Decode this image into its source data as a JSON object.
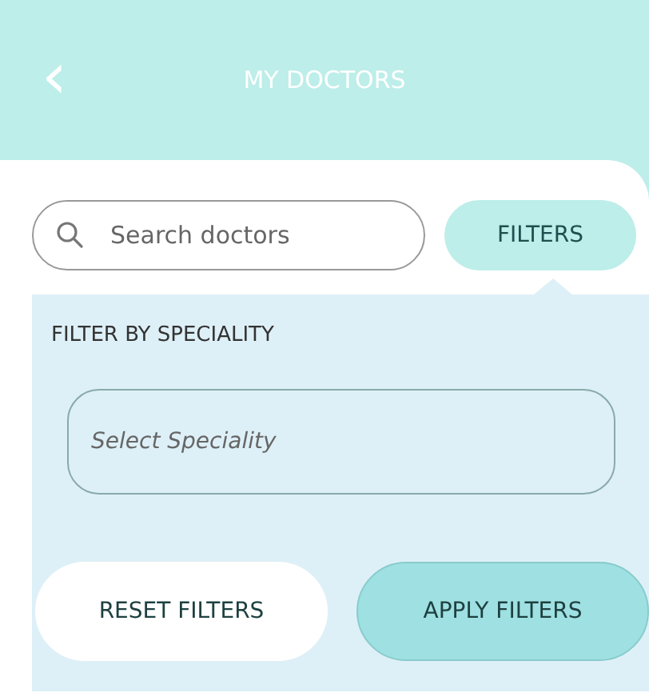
{
  "header": {
    "back_icon": "‹",
    "title": "MY DOCTORS"
  },
  "search": {
    "placeholder": "Search doctors"
  },
  "filters_button": "FILTERS",
  "filter_panel": {
    "label": "FILTER BY SPECIALITY",
    "select": {
      "placeholder": "Select Speciality"
    },
    "buttons": [
      {
        "label": "RESET FILTERS",
        "kind": "secondary"
      },
      {
        "label": "APPLY FILTERS",
        "kind": "primary"
      }
    ]
  }
}
